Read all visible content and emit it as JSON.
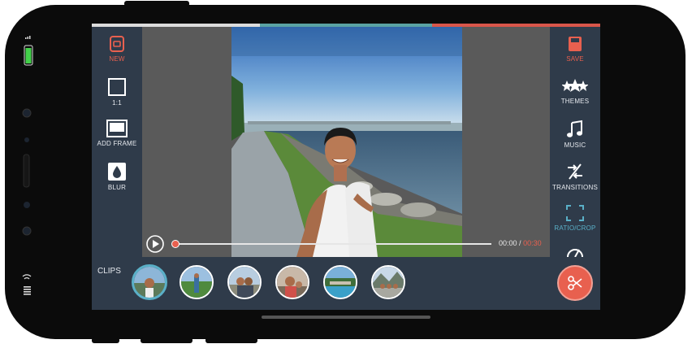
{
  "left_tools": [
    {
      "label": "NEW",
      "icon": "new-project-icon"
    },
    {
      "label": "1:1",
      "icon": "square-icon"
    },
    {
      "label": "ADD FRAME",
      "icon": "frame-icon"
    },
    {
      "label": "BLUR",
      "icon": "blur-drop-icon"
    }
  ],
  "right_tools": [
    {
      "label": "SAVE",
      "icon": "save-icon"
    },
    {
      "label": "THEMES",
      "icon": "themes-stars-icon"
    },
    {
      "label": "MUSIC",
      "icon": "music-note-icon"
    },
    {
      "label": "TRANSITIONS",
      "icon": "transitions-icon"
    },
    {
      "label": "RATIO/CROP",
      "icon": "crop-icon"
    },
    {
      "label": "",
      "icon": "speed-icon"
    }
  ],
  "player": {
    "current_time": "00:00",
    "separator": "/",
    "total_time": "00:30",
    "progress": 0.0
  },
  "clips": {
    "label": "CLIPS",
    "count": 6,
    "selected_index": 0
  },
  "colors": {
    "accent_red": "#e8604f",
    "accent_teal": "#5ab0c8",
    "panel": "#2f3b4a"
  }
}
